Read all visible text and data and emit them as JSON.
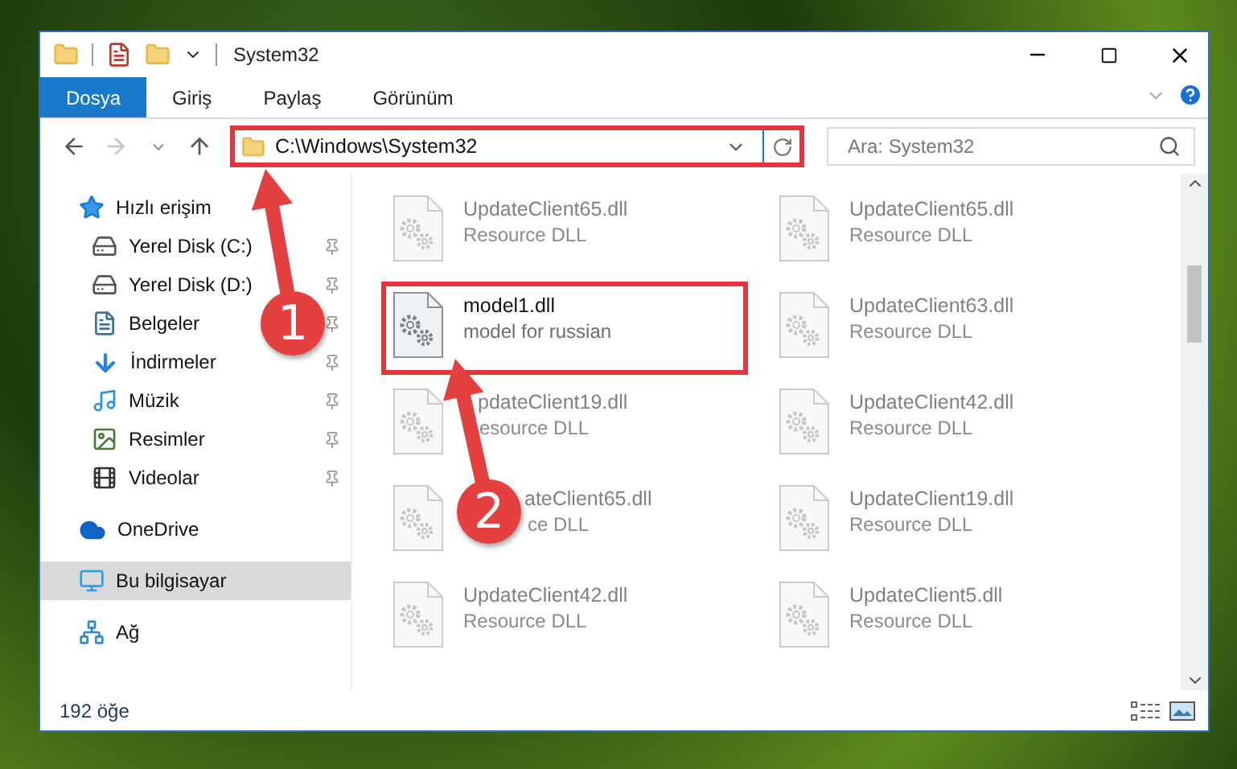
{
  "window": {
    "title": "System32"
  },
  "ribbon_tabs": [
    {
      "label": "Dosya",
      "selected": true
    },
    {
      "label": "Giriş",
      "selected": false
    },
    {
      "label": "Paylaş",
      "selected": false
    },
    {
      "label": "Görünüm",
      "selected": false
    }
  ],
  "address": {
    "path": "C:\\Windows\\System32",
    "highlighted": true
  },
  "search": {
    "placeholder": "Ara: System32"
  },
  "sidebar": {
    "items": [
      {
        "label": "Hızlı erişim",
        "kind": "quick",
        "selected": false,
        "children": [
          {
            "label": "Yerel Disk (C:)",
            "kind": "system-drive",
            "selected": false,
            "pinned": true
          },
          {
            "label": "Yerel Disk (D:)",
            "kind": "drive",
            "selected": false,
            "pinned": true
          },
          {
            "label": "Belgeler",
            "kind": "documents",
            "selected": false,
            "pinned": true
          },
          {
            "label": "İndirmeler",
            "kind": "downloads",
            "selected": false,
            "pinned": true
          },
          {
            "label": "Müzik",
            "kind": "music",
            "selected": false,
            "pinned": true
          },
          {
            "label": "Resimler",
            "kind": "pictures",
            "selected": false,
            "pinned": true
          },
          {
            "label": "Videolar",
            "kind": "videos",
            "selected": false,
            "pinned": true
          }
        ]
      },
      {
        "label": "OneDrive",
        "kind": "cloud",
        "selected": false
      },
      {
        "label": "Bu bilgisayar",
        "kind": "pc",
        "selected": true
      },
      {
        "label": "Ağ",
        "kind": "network",
        "selected": false
      }
    ]
  },
  "files": [
    {
      "name": "UpdateClient65.dll",
      "type": "Resource DLL",
      "dimmed": true,
      "highlighted": false
    },
    {
      "name": "UpdateClient65.dll",
      "type": "Resource DLL",
      "dimmed": true,
      "highlighted": false
    },
    {
      "name": "model1.dll",
      "type": "model for russian",
      "dimmed": false,
      "highlighted": true
    },
    {
      "name": "UpdateClient63.dll",
      "type": "Resource DLL",
      "dimmed": true,
      "highlighted": false
    },
    {
      "name": "pdateClient19.dll",
      "type": "esource DLL",
      "dimmed": true,
      "highlighted": false
    },
    {
      "name": "UpdateClient42.dll",
      "type": "Resource DLL",
      "dimmed": true,
      "highlighted": false
    },
    {
      "name": "ateClient65.dll",
      "type": "ce DLL",
      "dimmed": true,
      "highlighted": false
    },
    {
      "name": "UpdateClient19.dll",
      "type": "Resource DLL",
      "dimmed": true,
      "highlighted": false
    },
    {
      "name": "UpdateClient42.dll",
      "type": "Resource DLL",
      "dimmed": true,
      "highlighted": false
    },
    {
      "name": "UpdateClient5.dll",
      "type": "Resource DLL",
      "dimmed": true,
      "highlighted": false
    }
  ],
  "status_bar": {
    "item_count": "192 öğe"
  },
  "annotations": [
    {
      "number": "1"
    },
    {
      "number": "2"
    }
  ]
}
